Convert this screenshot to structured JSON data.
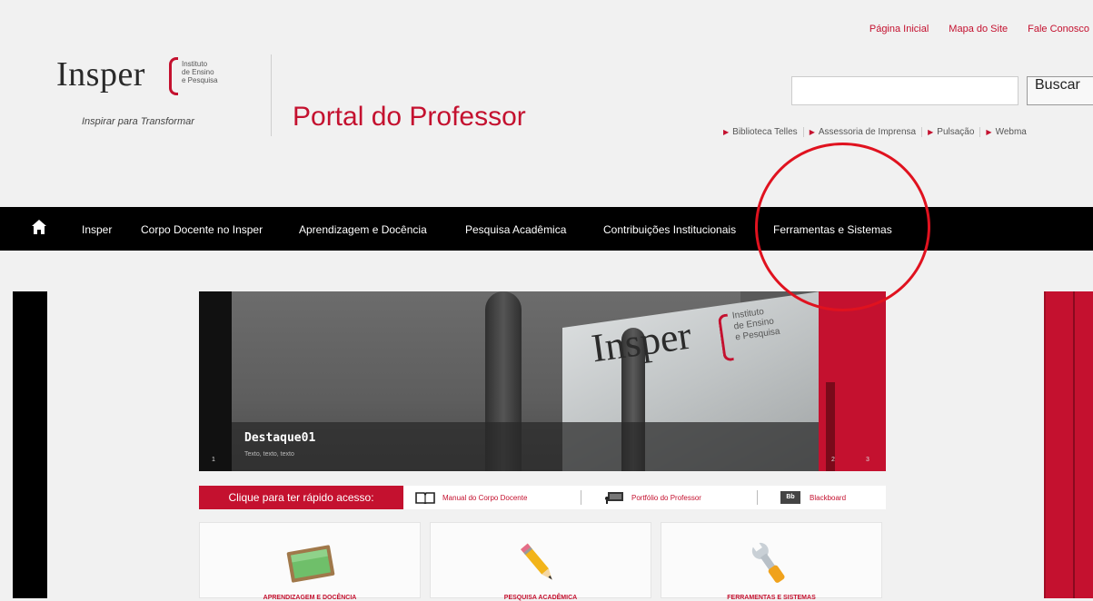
{
  "header": {
    "logo_word": "Insper",
    "logo_institute_lines": [
      "Instituto",
      "de Ensino",
      "e Pesquisa"
    ],
    "logo_tagline": "Inspirar para Transformar",
    "portal_title": "Portal do Professor",
    "top_links": [
      "Página Inicial",
      "Mapa do Site",
      "Fale Conosco"
    ],
    "search": {
      "value": "",
      "button_label": "Buscar"
    },
    "quick_links": [
      "Biblioteca Telles",
      "Assessoria de Imprensa",
      "Pulsação",
      "Webma"
    ]
  },
  "nav": {
    "home_icon": "home-icon",
    "items": [
      "Insper",
      "Corpo Docente no Insper",
      "Aprendizagem e Docência",
      "Pesquisa Acadêmica",
      "Contribuições Institucionais",
      "Ferramentas e Sistemas"
    ]
  },
  "banner": {
    "logo_word": "Insper",
    "institute_lines": [
      "Instituto",
      "de Ensino",
      "e Pesquisa"
    ],
    "title": "Destaque01",
    "subtitle": "Texto, texto, texto",
    "slide_index": "1",
    "nav_numbers": [
      "2",
      "3"
    ]
  },
  "quick_access": {
    "label": "Clique para ter rápido acesso:",
    "links": [
      {
        "label": "Manual do Corpo Docente",
        "icon": "book-icon"
      },
      {
        "label": "Portfólio do Professor",
        "icon": "presentation-icon"
      },
      {
        "label": "Blackboard",
        "icon": "blackboard-icon",
        "icon_text": "Bb"
      }
    ]
  },
  "cards": [
    {
      "label": "APRENDIZAGEM E DOCÊNCIA",
      "icon": "chalkboard-icon"
    },
    {
      "label": "PESQUISA ACADÊMICA",
      "icon": "pencil-icon"
    },
    {
      "label": "FERRAMENTAS E SISTEMAS",
      "icon": "wrench-icon"
    }
  ],
  "colors": {
    "brand_red": "#c4112f",
    "nav_bg": "#000000",
    "annotation": "#e0121f"
  }
}
